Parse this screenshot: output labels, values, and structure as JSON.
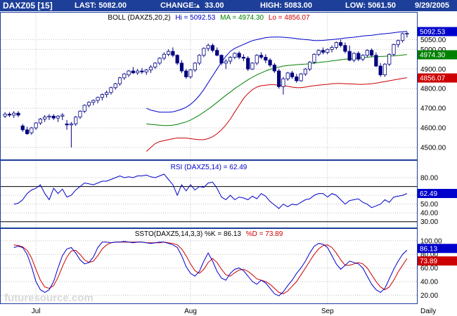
{
  "header": {
    "symbol": "DAXZ05 [15]",
    "last": "LAST: 5082.00",
    "change_label": "CHANGE:",
    "change_value": "33.00",
    "high": "HIGH: 5083.00",
    "low": "LOW: 5061.50",
    "date": "9/29/2005"
  },
  "watermark": "futuresource.com",
  "x_axis": {
    "labels": [
      "Jul",
      "Aug",
      "Sep"
    ],
    "label_index": [
      7,
      42,
      73
    ],
    "period": "Daily"
  },
  "colors": {
    "header_bg": "#1d3f9a",
    "candle_up": "#ffffff",
    "candle_down": "#000080",
    "upper_band": "#0000cc",
    "middle_band": "#008000",
    "lower_band": "#cc0000",
    "rsi_line": "#0000cc",
    "k_line": "#0000cc",
    "d_line": "#cc0000",
    "panel_border": "#1d3f9a",
    "grid": "#c0c0c0"
  },
  "price_panel": {
    "title": "BOLL (DAXZ5,20,2)",
    "upper_label": "Hi = 5092.53",
    "middle_label": "MA = 4974.30",
    "lower_label": "Lo = 4856.07",
    "ticks": [
      "4500.00",
      "4600.00",
      "4700.00",
      "4800.00",
      "4900.00",
      "5000.00",
      "5050.00"
    ],
    "tick_values": [
      4500,
      4600,
      4700,
      4800,
      4900,
      5000,
      5050
    ],
    "badges": {
      "upper": "5092.53",
      "middle": "4974.30",
      "lower": "4856.07"
    },
    "badge_values": {
      "upper": 5092.53,
      "middle": 4974.3,
      "lower": 4856.07
    },
    "ylim": [
      4450,
      5130
    ]
  },
  "rsi_panel": {
    "title": "RSI (DAXZ5,14) = 62.49",
    "ticks": [
      "30.00",
      "40.00",
      "50.00",
      "60.00",
      "80.00"
    ],
    "tick_values": [
      30,
      40,
      50,
      60,
      80
    ],
    "levels": [
      30,
      70
    ],
    "badge": "62.49",
    "badge_value": 62.49,
    "ylim": [
      25,
      88
    ]
  },
  "stoch_panel": {
    "title_prefix": "SSTO(DAXZ5,14,3,3) %K = 86.13",
    "title_suffix": "%D = 73.89",
    "ticks": [
      "20.00",
      "40.00",
      "60.00",
      "80.00",
      "100.00"
    ],
    "tick_values": [
      20,
      40,
      60,
      80,
      100
    ],
    "badge_k": "86.13",
    "badge_d": "73.89",
    "badge_k_value": 86.13,
    "badge_d_value": 73.89,
    "ylim": [
      10,
      105
    ]
  },
  "chart_data": [
    {
      "type": "candlestick",
      "title": "BOLL (DAXZ5,20,2)",
      "ylim": [
        4450,
        5130
      ],
      "candles": [
        [
          4660,
          4680,
          4650,
          4670
        ],
        [
          4670,
          4680,
          4655,
          4665
        ],
        [
          4665,
          4685,
          4650,
          4675
        ],
        [
          4675,
          4685,
          4655,
          4665
        ],
        [
          4610,
          4620,
          4580,
          4590
        ],
        [
          4590,
          4605,
          4565,
          4570
        ],
        [
          4575,
          4605,
          4565,
          4600
        ],
        [
          4600,
          4630,
          4590,
          4625
        ],
        [
          4625,
          4650,
          4615,
          4645
        ],
        [
          4645,
          4665,
          4630,
          4655
        ],
        [
          4655,
          4670,
          4640,
          4660
        ],
        [
          4660,
          4670,
          4640,
          4650
        ],
        [
          4650,
          4665,
          4630,
          4660
        ],
        [
          4660,
          4675,
          4640,
          4665
        ],
        [
          4620,
          4640,
          4590,
          4615
        ],
        [
          4615,
          4630,
          4500,
          4620
        ],
        [
          4620,
          4660,
          4610,
          4655
        ],
        [
          4655,
          4690,
          4645,
          4685
        ],
        [
          4685,
          4720,
          4675,
          4715
        ],
        [
          4715,
          4735,
          4705,
          4730
        ],
        [
          4730,
          4745,
          4715,
          4740
        ],
        [
          4740,
          4760,
          4725,
          4755
        ],
        [
          4755,
          4775,
          4740,
          4770
        ],
        [
          4770,
          4790,
          4755,
          4780
        ],
        [
          4780,
          4810,
          4770,
          4805
        ],
        [
          4805,
          4830,
          4795,
          4825
        ],
        [
          4825,
          4860,
          4815,
          4855
        ],
        [
          4855,
          4880,
          4845,
          4875
        ],
        [
          4870,
          4895,
          4860,
          4890
        ],
        [
          4890,
          4910,
          4875,
          4880
        ],
        [
          4880,
          4900,
          4870,
          4890
        ],
        [
          4890,
          4905,
          4875,
          4885
        ],
        [
          4885,
          4900,
          4870,
          4895
        ],
        [
          4895,
          4920,
          4880,
          4910
        ],
        [
          4910,
          4935,
          4900,
          4930
        ],
        [
          4930,
          4960,
          4920,
          4955
        ],
        [
          4955,
          4985,
          4945,
          4975
        ],
        [
          4975,
          5000,
          4965,
          4990
        ],
        [
          4990,
          5010,
          4960,
          4970
        ],
        [
          4970,
          4975,
          4920,
          4930
        ],
        [
          4930,
          4945,
          4880,
          4890
        ],
        [
          4890,
          4900,
          4850,
          4860
        ],
        [
          4860,
          4900,
          4850,
          4895
        ],
        [
          4895,
          4935,
          4885,
          4930
        ],
        [
          4930,
          4975,
          4920,
          4970
        ],
        [
          4970,
          5010,
          4960,
          5005
        ],
        [
          5005,
          5030,
          4990,
          5020
        ],
        [
          5020,
          5030,
          4985,
          4995
        ],
        [
          4995,
          5010,
          4965,
          4970
        ],
        [
          4970,
          4975,
          4920,
          4930
        ],
        [
          4930,
          4950,
          4900,
          4940
        ],
        [
          4940,
          4965,
          4925,
          4960
        ],
        [
          4960,
          4985,
          4950,
          4980
        ],
        [
          4980,
          4990,
          4950,
          4960
        ],
        [
          4960,
          4975,
          4940,
          4955
        ],
        [
          4955,
          4965,
          4890,
          4900
        ],
        [
          4900,
          4935,
          4895,
          4930
        ],
        [
          4930,
          4975,
          4920,
          4970
        ],
        [
          4970,
          4985,
          4950,
          4960
        ],
        [
          4960,
          4975,
          4930,
          4945
        ],
        [
          4945,
          4955,
          4910,
          4920
        ],
        [
          4920,
          4930,
          4880,
          4890
        ],
        [
          4890,
          4900,
          4800,
          4810
        ],
        [
          4810,
          4860,
          4770,
          4850
        ],
        [
          4850,
          4885,
          4840,
          4880
        ],
        [
          4880,
          4890,
          4850,
          4860
        ],
        [
          4860,
          4875,
          4830,
          4840
        ],
        [
          4840,
          4880,
          4835,
          4875
        ],
        [
          4875,
          4905,
          4865,
          4900
        ],
        [
          4900,
          4940,
          4890,
          4935
        ],
        [
          4935,
          4980,
          4925,
          4975
        ],
        [
          4975,
          5000,
          4965,
          4995
        ],
        [
          4995,
          5010,
          4975,
          4985
        ],
        [
          4985,
          5005,
          4975,
          5000
        ],
        [
          5000,
          5020,
          4985,
          5010
        ],
        [
          5010,
          5040,
          5000,
          5035
        ],
        [
          5035,
          5050,
          5010,
          5020
        ],
        [
          5020,
          5035,
          4980,
          4990
        ],
        [
          4990,
          5020,
          4940,
          4945
        ],
        [
          4945,
          4985,
          4935,
          4980
        ],
        [
          4980,
          4990,
          4940,
          4950
        ],
        [
          4950,
          4975,
          4940,
          4970
        ],
        [
          4970,
          5000,
          4960,
          4995
        ],
        [
          4995,
          5005,
          4960,
          4970
        ],
        [
          4970,
          4985,
          4910,
          4915
        ],
        [
          4915,
          4930,
          4860,
          4870
        ],
        [
          4870,
          4930,
          4860,
          4925
        ],
        [
          4925,
          4980,
          4915,
          4975
        ],
        [
          4975,
          5030,
          4965,
          5025
        ],
        [
          5025,
          5050,
          5010,
          5045
        ],
        [
          5045,
          5085,
          5035,
          5080
        ],
        [
          5080,
          5090,
          5060,
          5082
        ]
      ],
      "upper": [
        4700,
        4690,
        4685,
        4680,
        4680,
        4680,
        4682,
        4688,
        4695,
        4705,
        4720,
        4740,
        4765,
        4795,
        4830,
        4865,
        4900,
        4935,
        4965,
        4990,
        5005,
        5015,
        5025,
        5035,
        5045,
        5050,
        5055,
        5060,
        5062,
        5063,
        5063,
        5062,
        5060,
        5058,
        5055,
        5052,
        5050,
        5048,
        5045,
        5045,
        5046,
        5048,
        5050,
        5052,
        5055,
        5058,
        5060,
        5062,
        5065,
        5068,
        5070,
        5072,
        5075,
        5078,
        5080,
        5082,
        5085,
        5088,
        5090,
        5092
      ],
      "middle": [
        4620,
        4618,
        4616,
        4614,
        4612,
        4612,
        4614,
        4618,
        4624,
        4630,
        4640,
        4652,
        4665,
        4680,
        4695,
        4712,
        4730,
        4748,
        4766,
        4782,
        4800,
        4815,
        4830,
        4845,
        4858,
        4870,
        4880,
        4890,
        4898,
        4905,
        4910,
        4915,
        4918,
        4920,
        4922,
        4924,
        4925,
        4927,
        4930,
        4933,
        4936,
        4938,
        4941,
        4944,
        4947,
        4950,
        4952,
        4954,
        4956,
        4958,
        4960,
        4962,
        4963,
        4964,
        4965,
        4966,
        4967,
        4969,
        4971,
        4974
      ],
      "lower": [
        4480,
        4500,
        4520,
        4530,
        4535,
        4540,
        4545,
        4548,
        4548,
        4548,
        4545,
        4542,
        4540,
        4540,
        4545,
        4555,
        4570,
        4590,
        4615,
        4645,
        4680,
        4715,
        4750,
        4775,
        4795,
        4808,
        4815,
        4818,
        4820,
        4820,
        4818,
        4816,
        4812,
        4808,
        4805,
        4805,
        4808,
        4812,
        4815,
        4818,
        4820,
        4822,
        4825,
        4826,
        4826,
        4825,
        4824,
        4823,
        4822,
        4822,
        4823,
        4825,
        4828,
        4832,
        4836,
        4840,
        4844,
        4848,
        4852,
        4856
      ]
    },
    {
      "type": "line",
      "title": "RSI (DAXZ5,14) = 62.49",
      "ylim": [
        25,
        88
      ],
      "series": [
        {
          "name": "RSI (DAXZ5,14)",
          "values": [
            50,
            51,
            55,
            62,
            66,
            68,
            72,
            62,
            55,
            68,
            62,
            67,
            58,
            60,
            66,
            70,
            74,
            73,
            72,
            74,
            76,
            76,
            78,
            80,
            82,
            80,
            81,
            80,
            82,
            82,
            83,
            81,
            80,
            82,
            84,
            78,
            72,
            60,
            72,
            65,
            72,
            66,
            70,
            69,
            74,
            75,
            68,
            58,
            55,
            60,
            55,
            58,
            57,
            55,
            59,
            56,
            62,
            59,
            53,
            49,
            45,
            50,
            47,
            50,
            49,
            52,
            55,
            56,
            60,
            62,
            62,
            58,
            62,
            60,
            55,
            50,
            54,
            55,
            56,
            52,
            50,
            46,
            48,
            50,
            55,
            52,
            58,
            59,
            60,
            62
          ]
        }
      ]
    },
    {
      "type": "line",
      "title": "SSTO(DAXZ5,14,3,3)",
      "ylim": [
        10,
        105
      ],
      "series": [
        {
          "name": "%K",
          "values": [
            90,
            92,
            90,
            80,
            62,
            40,
            28,
            24,
            28,
            40,
            60,
            78,
            88,
            90,
            82,
            72,
            66,
            68,
            76,
            90,
            98,
            98,
            97,
            98,
            98,
            99,
            98,
            97,
            98,
            98,
            97,
            96,
            97,
            98,
            98,
            96,
            94,
            90,
            78,
            62,
            52,
            48,
            55,
            70,
            82,
            70,
            55,
            45,
            42,
            52,
            58,
            60,
            56,
            48,
            40,
            36,
            42,
            38,
            30,
            22,
            19,
            25,
            34,
            42,
            52,
            60,
            70,
            82,
            92,
            96,
            95,
            90,
            78,
            66,
            58,
            64,
            70,
            68,
            66,
            60,
            48,
            36,
            28,
            24,
            30,
            44,
            58,
            70,
            80,
            86.13
          ]
        },
        {
          "name": "%D",
          "values": [
            94,
            93,
            91,
            86,
            75,
            58,
            42,
            32,
            30,
            34,
            46,
            62,
            76,
            85,
            86,
            80,
            72,
            68,
            70,
            78,
            88,
            94,
            97,
            98,
            98,
            98,
            98,
            98,
            98,
            98,
            97,
            97,
            97,
            97,
            98,
            97,
            96,
            94,
            88,
            78,
            66,
            56,
            52,
            58,
            68,
            74,
            68,
            58,
            50,
            48,
            53,
            57,
            58,
            55,
            50,
            44,
            42,
            40,
            36,
            30,
            24,
            22,
            26,
            33,
            40,
            50,
            60,
            70,
            80,
            88,
            93,
            94,
            90,
            82,
            72,
            64,
            64,
            66,
            68,
            66,
            60,
            50,
            40,
            32,
            28,
            32,
            42,
            54,
            64,
            73.89
          ]
        }
      ]
    }
  ]
}
